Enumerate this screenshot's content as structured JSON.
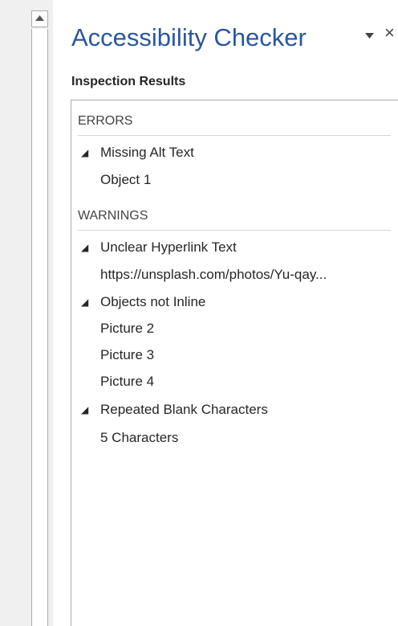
{
  "pane": {
    "title": "Accessibility Checker",
    "menu_icon": "dropdown-triangle-icon",
    "close_icon": "close-icon",
    "close_glyph": "×"
  },
  "section_label": "Inspection Results",
  "scrollbar": {
    "up_icon": "scroll-up-arrow-icon"
  },
  "results": {
    "errors": {
      "header": "ERRORS",
      "issues": [
        {
          "title": "Missing Alt Text",
          "items": [
            "Object 1"
          ]
        }
      ]
    },
    "warnings": {
      "header": "WARNINGS",
      "issues": [
        {
          "title": "Unclear Hyperlink Text",
          "items": [
            "https://unsplash.com/photos/Yu-qay..."
          ]
        },
        {
          "title": "Objects not Inline",
          "items": [
            "Picture 2",
            "Picture 3",
            "Picture 4"
          ]
        },
        {
          "title": "Repeated Blank Characters",
          "items": [
            "5 Characters"
          ]
        }
      ]
    }
  },
  "colors": {
    "title": "#2b579a",
    "text": "#262626",
    "border": "#ababab"
  }
}
